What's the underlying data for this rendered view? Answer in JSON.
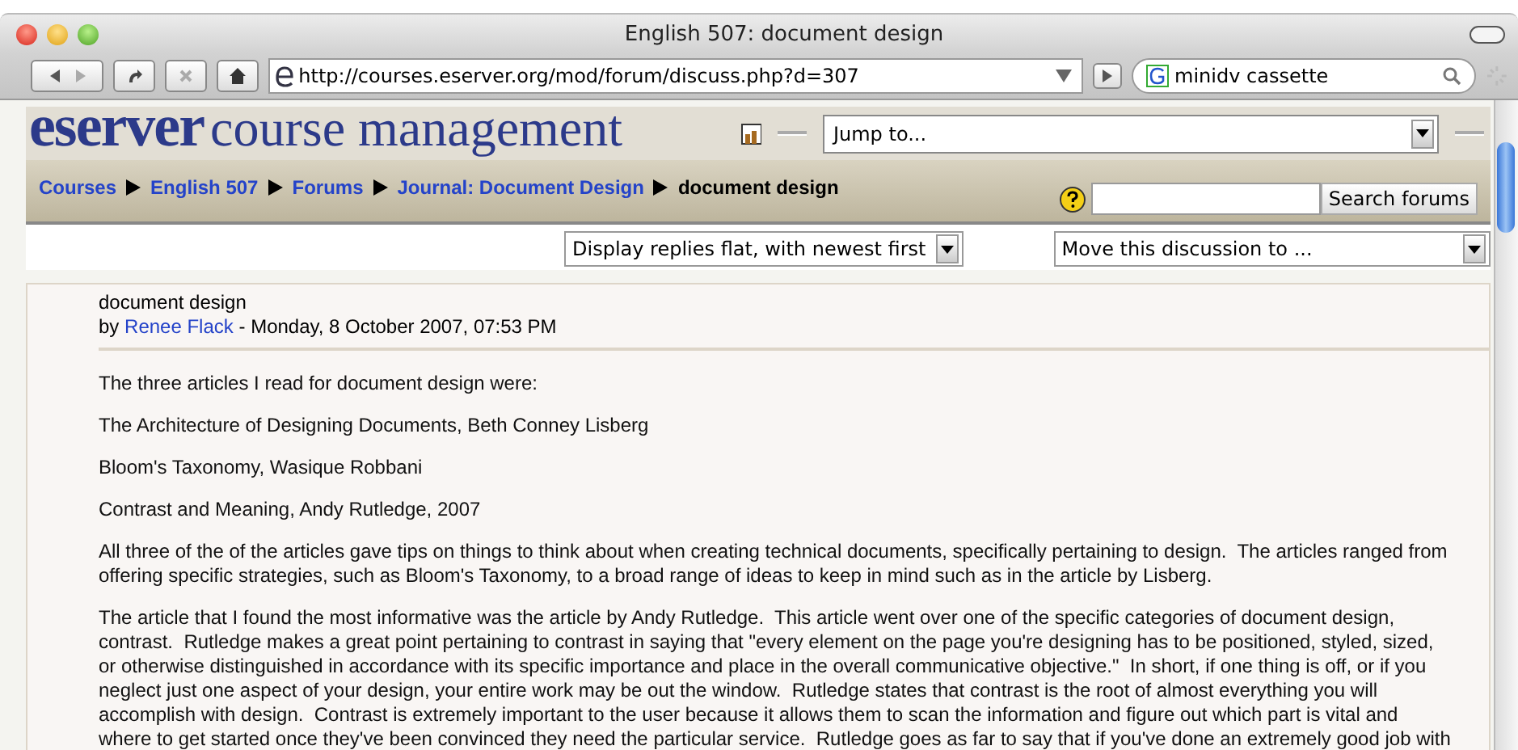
{
  "window": {
    "title": "English 507: document design"
  },
  "toolbar": {
    "url": "http://courses.eserver.org/mod/forum/discuss.php?d=307",
    "search_value": "minidv cassette"
  },
  "site": {
    "logo_bold": "eserver",
    "logo_rest": "course management",
    "jump_placeholder": "Jump to..."
  },
  "breadcrumb": [
    {
      "label": "Courses",
      "kind": "link"
    },
    {
      "label": "English 507",
      "kind": "link"
    },
    {
      "label": "Forums",
      "kind": "link"
    },
    {
      "label": "Journal: Document Design",
      "kind": "link"
    },
    {
      "label": "document design",
      "kind": "current"
    }
  ],
  "search_button": "Search forums",
  "display_select": "Display replies flat, with newest first",
  "move_select": "Move this discussion to ...",
  "post": {
    "subject": "document design",
    "by": "by",
    "author": "Renee Flack",
    "date": "- Monday, 8 October 2007, 07:53 PM",
    "paragraphs": [
      [
        "The three articles I read for document design were:"
      ],
      [
        "The Architecture of Designing Documents, Beth Conney Lisberg"
      ],
      [
        "Bloom's Taxonomy, Wasique Robbani"
      ],
      [
        "Contrast and Meaning, Andy Rutledge, 2007"
      ],
      [
        "All three of the of the articles gave tips on things to think about when creating technical documents, specifically pertaining to design.  The articles ranged from",
        "offering specific strategies, such as Bloom's Taxonomy, to a broad range of ideas to keep in mind such as in the article by Lisberg."
      ],
      [
        "The article that I found the most informative was the article by Andy Rutledge.  This article went over one of the specific categories of document design,",
        "contrast.  Rutledge makes a great point pertaining to contrast in saying that \"every element on the page you're designing has to be positioned, styled, sized,",
        "or otherwise distinguished in accordance with its specific importance and place in the overall communicative objective.\"  In short, if one thing is off, or if you",
        "neglect just one aspect of your design, your entire work may be out the window.  Rutledge states that contrast is the root of almost everything you will",
        "accomplish with design.  Contrast is extremely important to the user because it allows them to scan the information and figure out which part is vital and",
        "where to get started once they've been convinced they need the particular service.  Rutledge goes as far to say that if you've done an extremely good job with"
      ]
    ]
  }
}
